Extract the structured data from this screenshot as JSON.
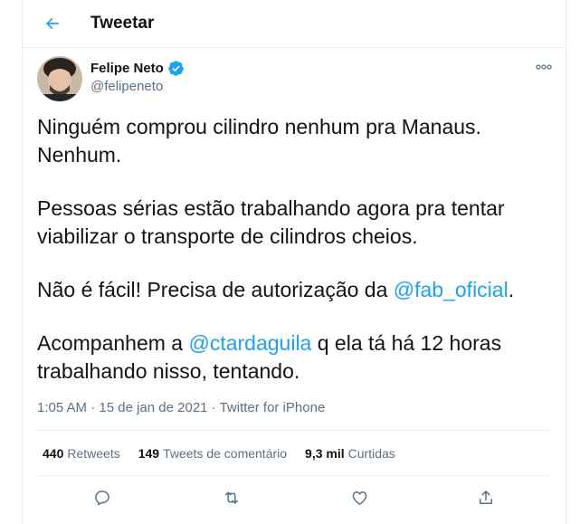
{
  "header": {
    "title": "Tweetar"
  },
  "author": {
    "name": "Felipe Neto",
    "handle": "@felipeneto"
  },
  "tweet": {
    "p1": "Ninguém comprou cilindro nenhum pra Manaus. Nenhum.",
    "p2": "Pessoas sérias estão trabalhando agora pra tentar viabilizar o transporte de cilindros cheios.",
    "p3_text": "Não é fácil! Precisa de autorização da ",
    "p3_mention": "@fab_oficial",
    "p3_end": ".",
    "p4_start": "Acompanhem a ",
    "p4_mention": "@ctardaguila",
    "p4_end": " q ela tá há 12 horas trabalhando nisso, tentando."
  },
  "meta": {
    "time": "1:05 AM",
    "sep": " · ",
    "date": "15 de jan de 2021",
    "source": "Twitter for iPhone"
  },
  "stats": {
    "retweets_count": "440",
    "retweets_label": "Retweets",
    "replies_count": "149",
    "replies_label": "Tweets de comentário",
    "likes_count": "9,3 mil",
    "likes_label": "Curtidas"
  },
  "colors": {
    "accent": "#1da1f2",
    "text": "#0f1419",
    "muted": "#5b7083"
  },
  "icons": [
    "back-arrow-icon",
    "verified-badge-icon",
    "more-options-icon",
    "reply-icon",
    "retweet-icon",
    "like-icon",
    "share-icon"
  ]
}
